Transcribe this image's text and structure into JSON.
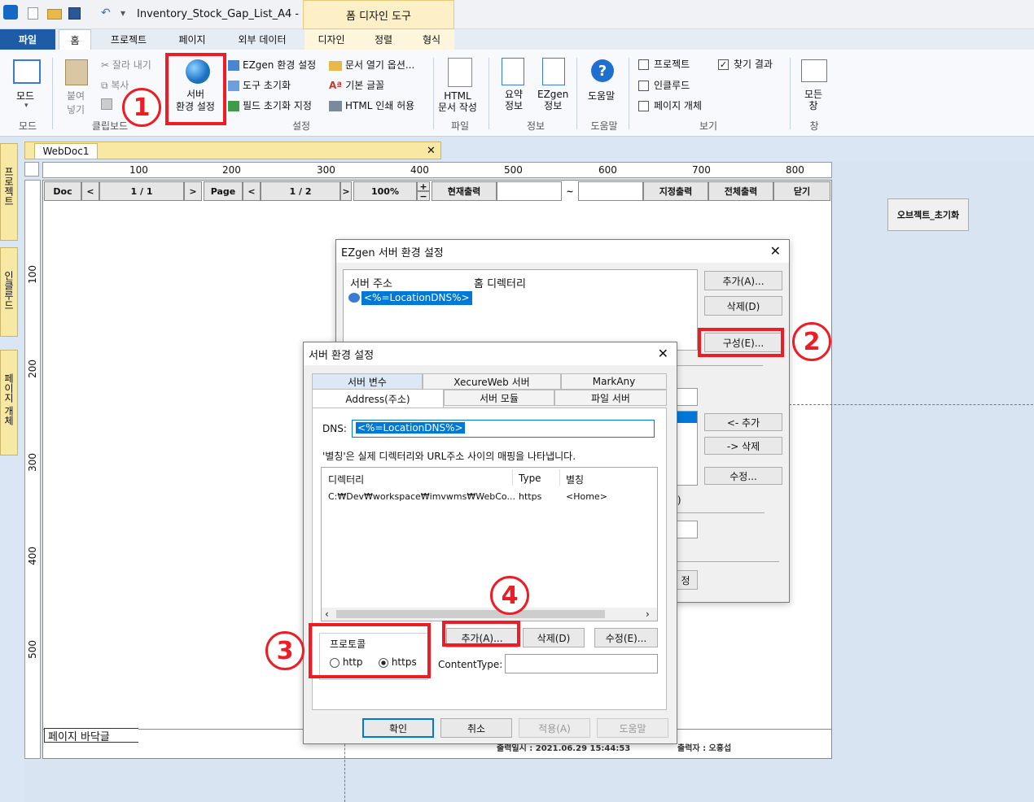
{
  "title_bar": {
    "doc_title": "Inventory_Stock_Gap_List_A4 - ...",
    "context_tab": "폼 디자인 도구"
  },
  "ribbon_tabs": [
    "파일",
    "홈",
    "프로젝트",
    "페이지",
    "외부 데이터",
    "디자인",
    "정렬",
    "형식"
  ],
  "ribbon": {
    "mode": {
      "label": "모드",
      "group": "모드"
    },
    "clipboard": {
      "paste": "붙여\n넣기",
      "cut": "잘라 내기",
      "copy": "복사",
      "group": "클립보드"
    },
    "settings": {
      "server": "서버\n환경 설정",
      "ezgen_env": "EZgen 환경 설정",
      "tool_init": "도구 초기화",
      "field_init": "필드 초기화 지정",
      "doc_open": "문서 열기 옵션...",
      "base_font": "기본 글꼴",
      "html_print": "HTML 인쇄 허용",
      "group": "설정"
    },
    "file": {
      "html_doc": "HTML\n문서 작성",
      "group": "파일"
    },
    "info": {
      "summary": "요약\n정보",
      "ezgen": "EZgen\n정보",
      "group": "정보"
    },
    "help": {
      "label": "도움말",
      "group": "도움말"
    },
    "view": {
      "project": "프로젝트",
      "include": "인클루드",
      "page_obj": "페이지 개체",
      "find": "찾기 결과",
      "group": "보기"
    },
    "window": {
      "all": "모든\n창",
      "group": "창"
    }
  },
  "side_panels": [
    "프로젝트",
    "인클루드",
    "페이지 개체"
  ],
  "doc_tab": "WebDoc1",
  "ruler_h": [
    "100",
    "200",
    "300",
    "400",
    "500",
    "600",
    "700",
    "800"
  ],
  "ruler_v": [
    "100",
    "200",
    "300",
    "400",
    "500"
  ],
  "toolbar": {
    "doc": "Doc",
    "prev": "<",
    "page1": "1 / 1",
    "next": ">",
    "page": "Page",
    "prev2": "<",
    "page2": "1 / 2",
    "next2": ">",
    "zoom": "100%",
    "plus": "+",
    "minus": "−",
    "current": "현재출력",
    "tilde": "~",
    "range": "지정출력",
    "all": "전체출력",
    "close": "닫기"
  },
  "obj_init": "오브젝트_초기화",
  "footer": {
    "watermark": "페이지 바닥글",
    "print_date": "출력일시 : 2021.06.29 15:44:53",
    "printer": "출력자 : 오홍섭"
  },
  "dlg1": {
    "title": "EZgen 서버 환경 설정",
    "col1": "서버 주소",
    "col2": "홈 디렉터리",
    "row": "<%=LocationDNS%>",
    "add": "추가(A)...",
    "del": "삭제(D)",
    "config": "구성(E)...",
    "add2": "<- 추가",
    "del2": "-> 삭제",
    "edit": "수정...",
    "frag": "r)",
    "frag2": "정"
  },
  "dlg2": {
    "title": "서버 환경 설정",
    "tabs_row1": [
      "서버 변수",
      "XecureWeb 서버",
      "MarkAny"
    ],
    "tabs_row2": [
      "Address(주소)",
      "서버 모듈",
      "파일 서버"
    ],
    "dns_label": "DNS:",
    "dns_value": "<%=LocationDNS%>",
    "desc": "'별칭'은 실제 디렉터리와 URL주소 사이의 매핑을 나타냅니다.",
    "cols": [
      "디렉터리",
      "Type",
      "별칭"
    ],
    "rows": [
      [
        "C:₩Dev₩workspace₩imvwms₩WebCo...",
        "https",
        "<Home>"
      ]
    ],
    "protocol": "프로토콜",
    "http": "http",
    "https": "https",
    "add": "추가(A)...",
    "del": "삭제(D)",
    "edit": "수정(E)...",
    "ctype": "ContentType:",
    "ok": "확인",
    "cancel": "취소",
    "apply": "적용(A)",
    "help": "도움말"
  },
  "markers": [
    "1",
    "2",
    "3",
    "4"
  ],
  "colors": {
    "accent": "#1e5ca8",
    "highlight": "#ee1c25",
    "selection": "#0078d7"
  }
}
